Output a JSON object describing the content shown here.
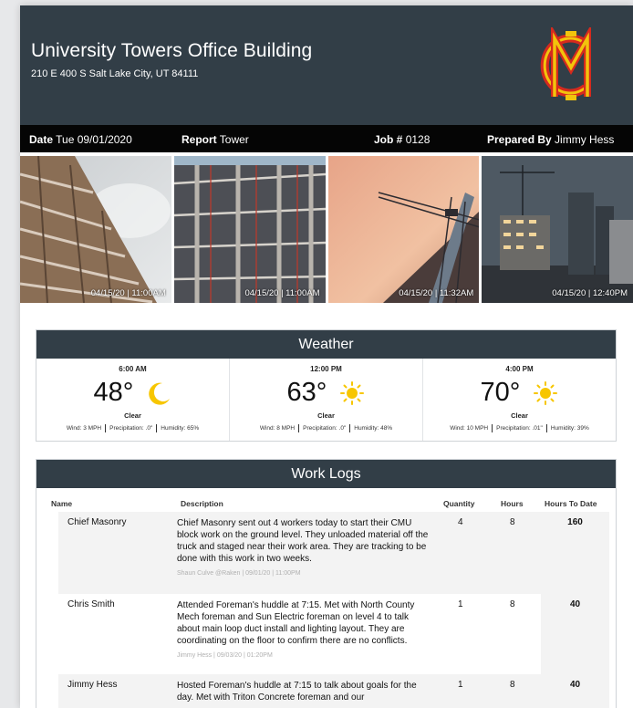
{
  "header": {
    "title": "University Towers Office Building",
    "address": "210 E 400 S Salt Lake City, UT 84111",
    "logo_icon": "mc-monogram-logo"
  },
  "info": {
    "date_label": "Date",
    "date_value": "Tue 09/01/2020",
    "report_label": "Report",
    "report_value": "Tower",
    "job_label": "Job #",
    "job_value": "0128",
    "prepared_label": "Prepared By",
    "prepared_value": "Jimmy Hess"
  },
  "photos": [
    {
      "stamp": "04/15/20 | 11:00AM"
    },
    {
      "stamp": "04/15/20 | 11:00AM"
    },
    {
      "stamp": "04/15/20 | 11:32AM"
    },
    {
      "stamp": "04/15/20 | 12:40PM"
    }
  ],
  "weather": {
    "title": "Weather",
    "slots": [
      {
        "time": "6:00 AM",
        "temp": "48°",
        "icon": "moon-icon",
        "condition": "Clear",
        "wind": "Wind: 3 MPH",
        "precip": "Precipitation: .0\"",
        "humidity": "Humidity: 65%"
      },
      {
        "time": "12:00 PM",
        "temp": "63°",
        "icon": "sun-icon",
        "condition": "Clear",
        "wind": "Wind: 8 MPH",
        "precip": "Precipitation: .0\"",
        "humidity": "Humidity: 48%"
      },
      {
        "time": "4:00 PM",
        "temp": "70°",
        "icon": "sun-icon",
        "condition": "Clear",
        "wind": "Wind: 10 MPH",
        "precip": "Precipitation: .01\"",
        "humidity": "Humidity: 39%"
      }
    ]
  },
  "worklogs": {
    "title": "Work Logs",
    "columns": {
      "name": "Name",
      "description": "Description",
      "quantity": "Quantity",
      "hours": "Hours",
      "hours_to_date": "Hours To Date"
    },
    "rows": [
      {
        "name": "Chief Masonry",
        "description": "Chief Masonry sent out 4 workers today to start their CMU block work on the ground level. They unloaded material off the truck and staged near their work area. They are tracking to be done with this work in two weeks.",
        "byline": "Shaun Culve @Raken | 09/01/20 | 11:00PM",
        "quantity": "4",
        "hours": "8",
        "hours_to_date": "160"
      },
      {
        "name": "Chris Smith",
        "description": "Attended Foreman's huddle at 7:15. Met with North County Mech foreman and Sun Electric foreman on level 4 to talk about main loop duct install and lighting layout. They are coordinating on the floor to confirm there are no conflicts.",
        "byline": "Jimmy Hess | 09/03/20 | 01:20PM",
        "quantity": "1",
        "hours": "8",
        "hours_to_date": "40"
      },
      {
        "name": "Jimmy Hess",
        "description": "Hosted Foreman's huddle at 7:15 to talk about goals for the day. Met with Triton Concrete foreman and our",
        "byline": "",
        "quantity": "1",
        "hours": "8",
        "hours_to_date": "40"
      }
    ]
  },
  "colors": {
    "header_bg": "#323e47",
    "infobar_bg": "#050505",
    "sun": "#f7c600",
    "logo_yellow": "#f2c40c",
    "logo_red": "#d62a1e"
  }
}
